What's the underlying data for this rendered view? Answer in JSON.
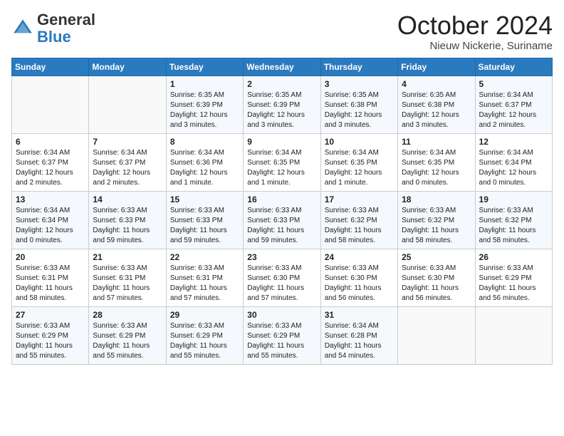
{
  "header": {
    "logo_general": "General",
    "logo_blue": "Blue",
    "month_title": "October 2024",
    "location": "Nieuw Nickerie, Suriname"
  },
  "days_of_week": [
    "Sunday",
    "Monday",
    "Tuesday",
    "Wednesday",
    "Thursday",
    "Friday",
    "Saturday"
  ],
  "weeks": [
    [
      {
        "day": "",
        "detail": ""
      },
      {
        "day": "",
        "detail": ""
      },
      {
        "day": "1",
        "detail": "Sunrise: 6:35 AM\nSunset: 6:39 PM\nDaylight: 12 hours and 3 minutes."
      },
      {
        "day": "2",
        "detail": "Sunrise: 6:35 AM\nSunset: 6:39 PM\nDaylight: 12 hours and 3 minutes."
      },
      {
        "day": "3",
        "detail": "Sunrise: 6:35 AM\nSunset: 6:38 PM\nDaylight: 12 hours and 3 minutes."
      },
      {
        "day": "4",
        "detail": "Sunrise: 6:35 AM\nSunset: 6:38 PM\nDaylight: 12 hours and 3 minutes."
      },
      {
        "day": "5",
        "detail": "Sunrise: 6:34 AM\nSunset: 6:37 PM\nDaylight: 12 hours and 2 minutes."
      }
    ],
    [
      {
        "day": "6",
        "detail": "Sunrise: 6:34 AM\nSunset: 6:37 PM\nDaylight: 12 hours and 2 minutes."
      },
      {
        "day": "7",
        "detail": "Sunrise: 6:34 AM\nSunset: 6:37 PM\nDaylight: 12 hours and 2 minutes."
      },
      {
        "day": "8",
        "detail": "Sunrise: 6:34 AM\nSunset: 6:36 PM\nDaylight: 12 hours and 1 minute."
      },
      {
        "day": "9",
        "detail": "Sunrise: 6:34 AM\nSunset: 6:35 PM\nDaylight: 12 hours and 1 minute."
      },
      {
        "day": "10",
        "detail": "Sunrise: 6:34 AM\nSunset: 6:35 PM\nDaylight: 12 hours and 1 minute."
      },
      {
        "day": "11",
        "detail": "Sunrise: 6:34 AM\nSunset: 6:35 PM\nDaylight: 12 hours and 0 minutes."
      },
      {
        "day": "12",
        "detail": "Sunrise: 6:34 AM\nSunset: 6:34 PM\nDaylight: 12 hours and 0 minutes."
      }
    ],
    [
      {
        "day": "13",
        "detail": "Sunrise: 6:34 AM\nSunset: 6:34 PM\nDaylight: 12 hours and 0 minutes."
      },
      {
        "day": "14",
        "detail": "Sunrise: 6:33 AM\nSunset: 6:33 PM\nDaylight: 11 hours and 59 minutes."
      },
      {
        "day": "15",
        "detail": "Sunrise: 6:33 AM\nSunset: 6:33 PM\nDaylight: 11 hours and 59 minutes."
      },
      {
        "day": "16",
        "detail": "Sunrise: 6:33 AM\nSunset: 6:33 PM\nDaylight: 11 hours and 59 minutes."
      },
      {
        "day": "17",
        "detail": "Sunrise: 6:33 AM\nSunset: 6:32 PM\nDaylight: 11 hours and 58 minutes."
      },
      {
        "day": "18",
        "detail": "Sunrise: 6:33 AM\nSunset: 6:32 PM\nDaylight: 11 hours and 58 minutes."
      },
      {
        "day": "19",
        "detail": "Sunrise: 6:33 AM\nSunset: 6:32 PM\nDaylight: 11 hours and 58 minutes."
      }
    ],
    [
      {
        "day": "20",
        "detail": "Sunrise: 6:33 AM\nSunset: 6:31 PM\nDaylight: 11 hours and 58 minutes."
      },
      {
        "day": "21",
        "detail": "Sunrise: 6:33 AM\nSunset: 6:31 PM\nDaylight: 11 hours and 57 minutes."
      },
      {
        "day": "22",
        "detail": "Sunrise: 6:33 AM\nSunset: 6:31 PM\nDaylight: 11 hours and 57 minutes."
      },
      {
        "day": "23",
        "detail": "Sunrise: 6:33 AM\nSunset: 6:30 PM\nDaylight: 11 hours and 57 minutes."
      },
      {
        "day": "24",
        "detail": "Sunrise: 6:33 AM\nSunset: 6:30 PM\nDaylight: 11 hours and 56 minutes."
      },
      {
        "day": "25",
        "detail": "Sunrise: 6:33 AM\nSunset: 6:30 PM\nDaylight: 11 hours and 56 minutes."
      },
      {
        "day": "26",
        "detail": "Sunrise: 6:33 AM\nSunset: 6:29 PM\nDaylight: 11 hours and 56 minutes."
      }
    ],
    [
      {
        "day": "27",
        "detail": "Sunrise: 6:33 AM\nSunset: 6:29 PM\nDaylight: 11 hours and 55 minutes."
      },
      {
        "day": "28",
        "detail": "Sunrise: 6:33 AM\nSunset: 6:29 PM\nDaylight: 11 hours and 55 minutes."
      },
      {
        "day": "29",
        "detail": "Sunrise: 6:33 AM\nSunset: 6:29 PM\nDaylight: 11 hours and 55 minutes."
      },
      {
        "day": "30",
        "detail": "Sunrise: 6:33 AM\nSunset: 6:29 PM\nDaylight: 11 hours and 55 minutes."
      },
      {
        "day": "31",
        "detail": "Sunrise: 6:34 AM\nSunset: 6:28 PM\nDaylight: 11 hours and 54 minutes."
      },
      {
        "day": "",
        "detail": ""
      },
      {
        "day": "",
        "detail": ""
      }
    ]
  ]
}
